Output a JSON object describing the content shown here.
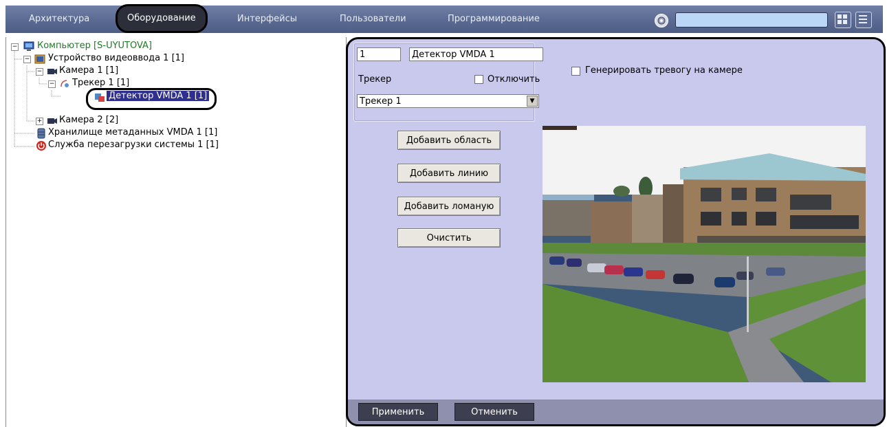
{
  "nav": {
    "tabs": [
      {
        "label": "Архитектура"
      },
      {
        "label": "Оборудование"
      },
      {
        "label": "Интерфейсы"
      },
      {
        "label": "Пользователи"
      },
      {
        "label": "Программирование"
      }
    ],
    "active_tab": "Оборудование"
  },
  "tree": {
    "items": [
      {
        "label": "Компьютер [S-UYUTOVA]",
        "icon": "computer-icon"
      },
      {
        "label": "Устройство видеоввода 1 [1]",
        "icon": "video-capture-icon"
      },
      {
        "label": "Камера 1 [1]",
        "icon": "camera-icon"
      },
      {
        "label": "Трекер 1 [1]",
        "icon": "tracker-icon"
      },
      {
        "label": "Детектор VMDA 1 [1]",
        "icon": "detector-icon"
      },
      {
        "label": "Камера 2 [2]",
        "icon": "camera-icon"
      },
      {
        "label": "Хранилище метаданных VMDA 1 [1]",
        "icon": "storage-icon"
      },
      {
        "label": "Служба перезагрузки системы 1 [1]",
        "icon": "power-icon"
      }
    ]
  },
  "form": {
    "id_value": "1",
    "name_value": "Детектор VMDA 1",
    "tracker_label": "Трекер",
    "disable_label": "Отключить",
    "tracker_select_value": "Трекер 1",
    "alarm_label": "Генерировать тревогу на камере",
    "add_area_label": "Добавить область",
    "add_line_label": "Добавить линию",
    "add_polyline_label": "Добавить ломаную",
    "clear_label": "Очистить"
  },
  "footer": {
    "apply_label": "Применить",
    "cancel_label": "Отменить"
  },
  "colors": {
    "topbar": "#5f6f98",
    "panel_bg": "#c8c9ec",
    "selection": "#2f2f8f",
    "footer_btn": "#3d3f50"
  }
}
